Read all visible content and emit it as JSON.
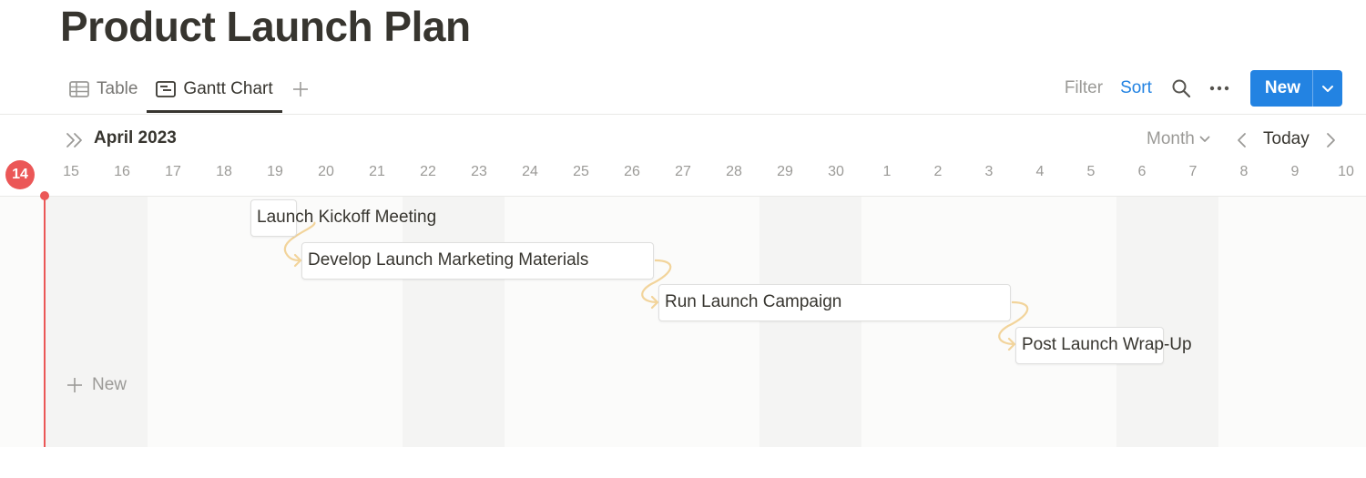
{
  "page": {
    "title": "Product Launch Plan"
  },
  "views": {
    "tabs": [
      {
        "label": "Table",
        "icon": "table-icon",
        "active": false
      },
      {
        "label": "Gantt Chart",
        "icon": "timeline-icon",
        "active": true
      }
    ],
    "add_icon": "plus-icon"
  },
  "toolbar": {
    "filter_label": "Filter",
    "sort_label": "Sort",
    "search_icon": "search-icon",
    "more_icon": "more-horizontal-icon",
    "new_label": "New",
    "new_caret_icon": "chevron-down-icon"
  },
  "calendar": {
    "month_label": "April 2023",
    "zoom_label": "Month",
    "today_label": "Today",
    "today_day": "14",
    "days": [
      "15",
      "16",
      "17",
      "18",
      "19",
      "20",
      "21",
      "22",
      "23",
      "24",
      "25",
      "26",
      "27",
      "28",
      "29",
      "30",
      "1",
      "2",
      "3",
      "4",
      "5",
      "6",
      "7",
      "8",
      "9",
      "10"
    ]
  },
  "tasks": [
    {
      "name": "Launch Kickoff Meeting",
      "start": "2023-04-19",
      "end": "2023-04-19"
    },
    {
      "name": "Develop Launch Marketing Materials",
      "start": "2023-04-20",
      "end": "2023-04-26"
    },
    {
      "name": "Run Launch Campaign",
      "start": "2023-04-27",
      "end": "2023-05-03"
    },
    {
      "name": "Post Launch Wrap-Up",
      "start": "2023-05-04",
      "end": "2023-05-06"
    }
  ],
  "add_row": {
    "label": "New"
  },
  "colors": {
    "accent": "#2383e2",
    "today": "#eb5757",
    "dependency": "#f2d49b",
    "text": "#37352f",
    "muted": "#9b9a97"
  }
}
